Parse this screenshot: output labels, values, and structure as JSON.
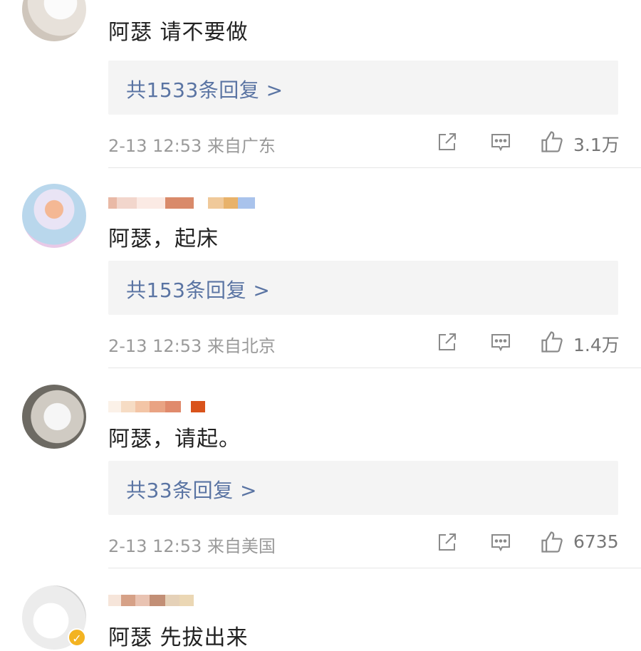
{
  "comments": [
    {
      "text": "阿瑟 请不要做",
      "reply": "共1533条回复 >",
      "time": "2-13 12:53",
      "location": "来自广东",
      "likes": "3.1万"
    },
    {
      "text": "阿瑟，起床",
      "reply": "共153条回复 >",
      "time": "2-13 12:53",
      "location": "来自北京",
      "likes": "1.4万"
    },
    {
      "text": "阿瑟，请起。",
      "reply": "共33条回复 >",
      "time": "2-13 12:53",
      "location": "来自美国",
      "likes": "6735"
    },
    {
      "text": "阿瑟 先拔出来"
    }
  ],
  "icons": {
    "share": "share-icon",
    "comment": "comment-icon",
    "like": "thumbs-up-icon",
    "verified": "verified-badge-icon"
  },
  "colors": {
    "reply_link": "#5a74a3",
    "meta_text": "#9a9a9a",
    "reply_box_bg": "#f4f4f4",
    "verified_badge": "#f3b321"
  }
}
